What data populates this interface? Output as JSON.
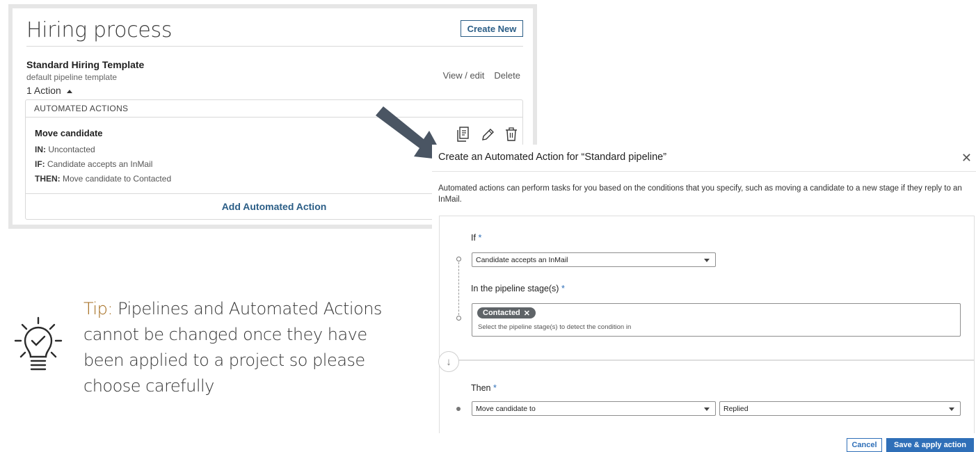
{
  "hiring_panel": {
    "title": "Hiring process",
    "create_new_label": "Create New",
    "template": {
      "name": "Standard Hiring Template",
      "description": "default pipeline template",
      "actions_count": "1 Action",
      "view_edit_label": "View / edit",
      "delete_label": "Delete"
    },
    "automated_actions": {
      "header": "AUTOMATED ACTIONS",
      "item": {
        "title": "Move candidate",
        "in_label": "IN:",
        "in_value": "Uncontacted",
        "if_label": "IF:",
        "if_value": "Candidate accepts an InMail",
        "then_label": "THEN:",
        "then_value": "Move candidate to Contacted",
        "icons": [
          "copy-icon",
          "pencil-icon",
          "trash-icon"
        ]
      },
      "add_label": "Add Automated Action"
    }
  },
  "arrow": {
    "color": "#4a5563"
  },
  "modal": {
    "title": "Create an Automated Action for “Standard pipeline”",
    "close_glyph": "✕",
    "description": "Automated actions can perform tasks for you based on the conditions that you specify, such as moving a candidate to a new stage if they reply to an InMail.",
    "if_label": "If",
    "required_mark": "*",
    "if_select_value": "Candidate accepts an InMail",
    "stage_label": "In the pipeline stage(s)",
    "stage_chip": "Contacted",
    "chip_remove_glyph": "✕",
    "stage_placeholder": "Select the pipeline stage(s) to detect the condition in",
    "down_glyph": "↓",
    "then_label": "Then",
    "then_action_value": "Move candidate to",
    "then_stage_value": "Replied",
    "cancel_label": "Cancel",
    "save_label": "Save & apply action",
    "accent_color": "#2f6fb8"
  },
  "tip": {
    "label": "Tip:",
    "text": "Pipelines and Automated Actions cannot be changed once they have been applied to a project so please choose carefully",
    "label_color": "#a36a1b",
    "icon": "lightbulb-check-icon"
  }
}
